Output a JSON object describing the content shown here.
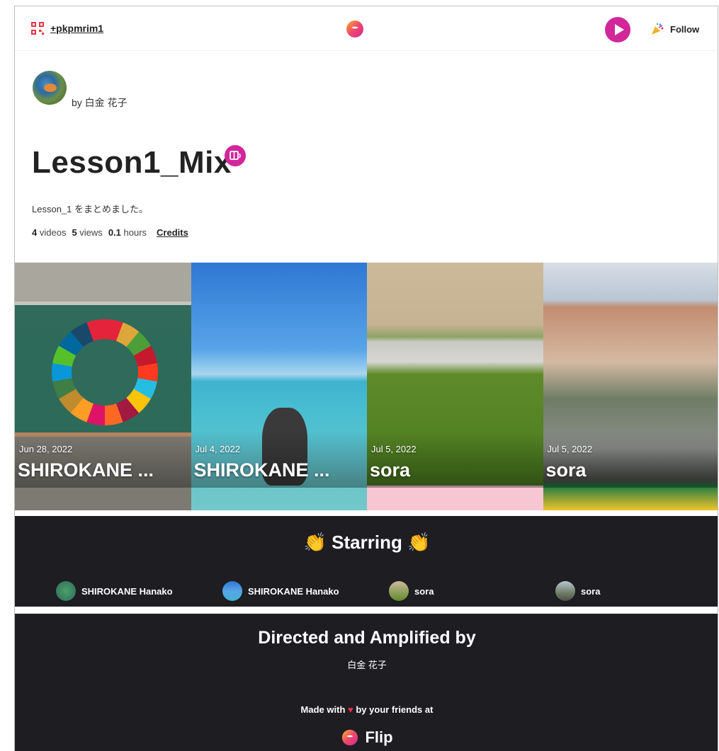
{
  "topbar": {
    "join_code": "+pkpmrim1",
    "follow_label": "Follow"
  },
  "header": {
    "byline": "by 白金 花子",
    "title": "Lesson1_Mix",
    "description": "Lesson_1 をまとめました。",
    "stats": {
      "videos_count": "4",
      "videos_label": "videos",
      "views_count": "5",
      "views_label": "views",
      "hours_count": "0.1",
      "hours_label": "hours",
      "credits_label": "Credits"
    }
  },
  "videos": [
    {
      "date": "Jun 28, 2022",
      "name": "SHIROKANE ..."
    },
    {
      "date": "Jul 4, 2022",
      "name": "SHIROKANE ..."
    },
    {
      "date": "Jul 5, 2022",
      "name": "sora"
    },
    {
      "date": "Jul 5, 2022",
      "name": "sora"
    }
  ],
  "starring": {
    "title": "Starring",
    "cast": [
      {
        "name": "SHIROKANE Hanako"
      },
      {
        "name": "SHIROKANE Hanako"
      },
      {
        "name": "sora"
      },
      {
        "name": "sora"
      }
    ]
  },
  "footer": {
    "directed_title": "Directed and Amplified by",
    "director_name": "白金 花子",
    "made_with_prefix": "Made with",
    "made_with_suffix": "by your friends at",
    "brand": "Flip"
  },
  "colors": {
    "accent": "#d1279a",
    "dark_bg": "#1d1d22",
    "heart": "#e8334a"
  }
}
